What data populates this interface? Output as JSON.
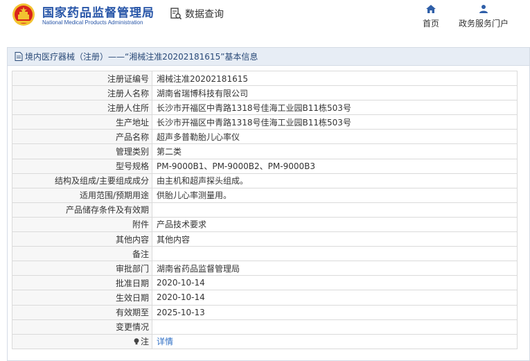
{
  "header": {
    "brand_cn": "国家药品监督管理局",
    "brand_en": "National Medical Products Administration",
    "query_label": "数据查询",
    "home_label": "首页",
    "portal_label": "政务服务门户",
    "icons": {
      "emblem": "national-emblem",
      "query": "document-search-icon",
      "home": "home-icon",
      "portal": "user-icon"
    },
    "colors": {
      "brand": "#2856a8",
      "emblem_red": "#d8231b",
      "emblem_gold": "#f2c230",
      "link": "#2f6fc5"
    }
  },
  "panel": {
    "title": "境内医疗器械（注册）——“湘械注准20202181615”基本信息",
    "title_icon": "document-icon"
  },
  "rows": [
    {
      "label": "注册证编号",
      "value": "湘械注准20202181615"
    },
    {
      "label": "注册人名称",
      "value": "湖南省瑞博科技有限公司"
    },
    {
      "label": "注册人住所",
      "value": "长沙市开福区中青路1318号佳海工业园B11栋503号"
    },
    {
      "label": "生产地址",
      "value": "长沙市开福区中青路1318号佳海工业园B11栋503号"
    },
    {
      "label": "产品名称",
      "value": "超声多普勒胎儿心率仪"
    },
    {
      "label": "管理类别",
      "value": "第二类"
    },
    {
      "label": "型号规格",
      "value": "PM-9000B1、PM-9000B2、PM-9000B3"
    },
    {
      "label": "结构及组成/主要组成成分",
      "value": "由主机和超声探头组成。"
    },
    {
      "label": "适用范围/预期用途",
      "value": "供胎儿心率测量用。"
    },
    {
      "label": "产品储存条件及有效期",
      "value": ""
    },
    {
      "label": "附件",
      "value": "产品技术要求"
    },
    {
      "label": "其他内容",
      "value": "其他内容"
    },
    {
      "label": "备注",
      "value": ""
    },
    {
      "label": "审批部门",
      "value": "湖南省药品监督管理局"
    },
    {
      "label": "批准日期",
      "value": "2020-10-14"
    },
    {
      "label": "生效日期",
      "value": "2020-10-14"
    },
    {
      "label": "有效期至",
      "value": "2025-10-13"
    },
    {
      "label": "变更情况",
      "value": ""
    }
  ],
  "note": {
    "label": "注",
    "link": "详情",
    "icon": "lightbulb-icon"
  }
}
